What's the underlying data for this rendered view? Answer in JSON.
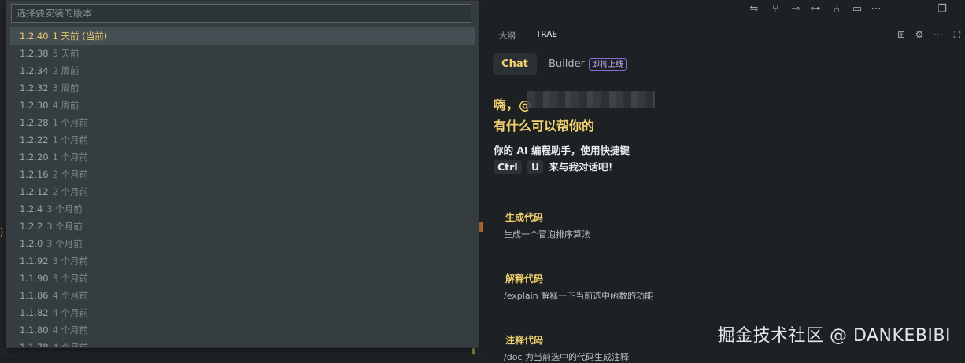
{
  "quickpick": {
    "placeholder": "选择要安装的版本",
    "items": [
      {
        "version": "1.2.40",
        "time": "1 天前 (当前)",
        "active": true
      },
      {
        "version": "1.2.38",
        "time": "5 天前"
      },
      {
        "version": "1.2.34",
        "time": "2 周前"
      },
      {
        "version": "1.2.32",
        "time": "3 周前"
      },
      {
        "version": "1.2.30",
        "time": "4 周前"
      },
      {
        "version": "1.2.28",
        "time": "1 个月前"
      },
      {
        "version": "1.2.22",
        "time": "1 个月前"
      },
      {
        "version": "1.2.20",
        "time": "1 个月前"
      },
      {
        "version": "1.2.16",
        "time": "2 个月前"
      },
      {
        "version": "1.2.12",
        "time": "2 个月前"
      },
      {
        "version": "1.2.4",
        "time": "3 个月前"
      },
      {
        "version": "1.2.2",
        "time": "3 个月前"
      },
      {
        "version": "1.2.0",
        "time": "3 个月前"
      },
      {
        "version": "1.1.92",
        "time": "3 个月前"
      },
      {
        "version": "1.1.90",
        "time": "3 个月前"
      },
      {
        "version": "1.1.86",
        "time": "4 个月前"
      },
      {
        "version": "1.1.82",
        "time": "4 个月前"
      },
      {
        "version": "1.1.80",
        "time": "4 个月前"
      },
      {
        "version": "1.1.78",
        "time": "4 个月前"
      }
    ]
  },
  "panel": {
    "tabs": [
      "大纲",
      "TRAE"
    ],
    "active_tab": "TRAE",
    "mode_chat": "Chat",
    "mode_builder": "Builder",
    "builder_badge": "即将上线",
    "greeting_prefix": "嗨，@",
    "greeting_line2": "有什么可以帮你的",
    "description": "你的 AI 编程助手，使用快捷键",
    "key1": "Ctrl",
    "key2": "U",
    "key_suffix": "来与我对话吧！",
    "suggestions": [
      {
        "title": "生成代码",
        "desc": "生成一个冒泡排序算法"
      },
      {
        "title": "解释代码",
        "desc": "/explain 解释一下当前选中函数的功能"
      },
      {
        "title": "注释代码",
        "desc": "/doc 为当前选中的代码生成注释"
      }
    ]
  },
  "watermark": "掘金技术社区 @ DANKEBIBI",
  "colors": {
    "accent": "#f3d36d",
    "badge_border": "#8a6bd6"
  }
}
